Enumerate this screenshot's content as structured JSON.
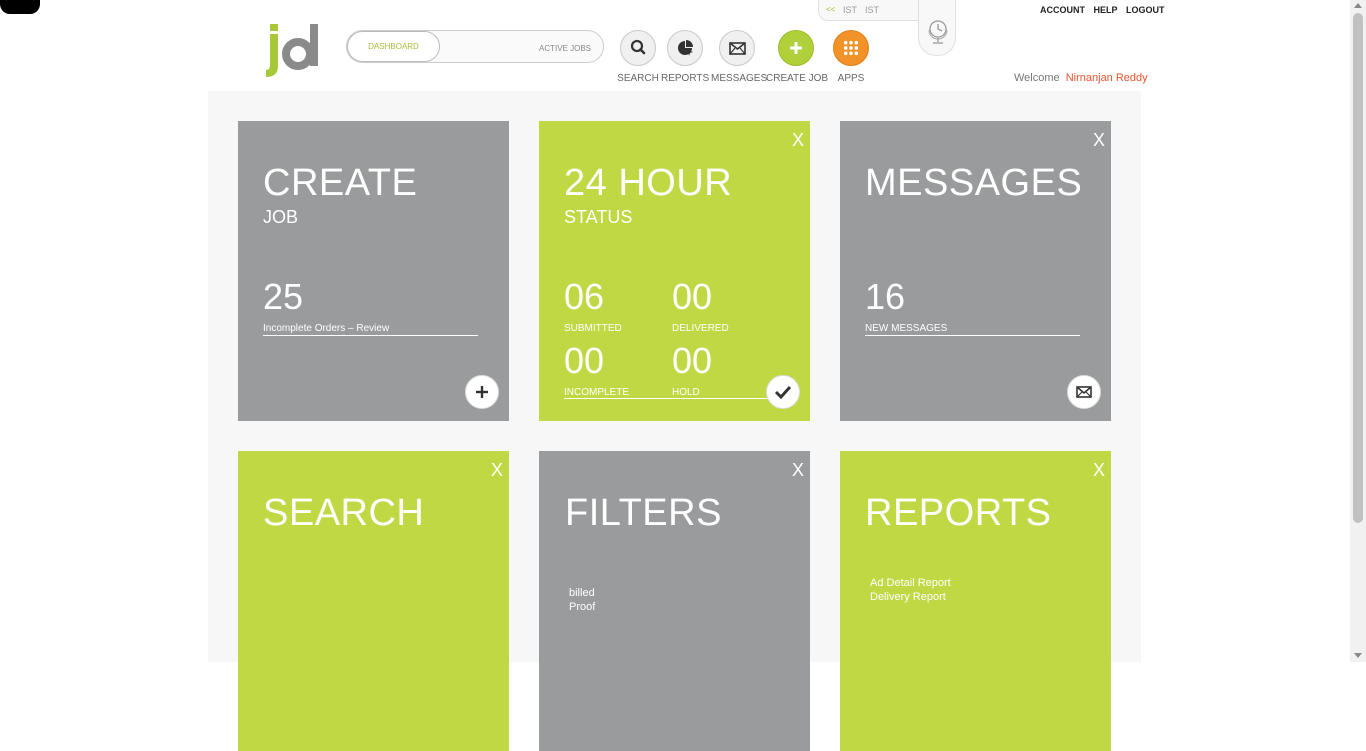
{
  "header": {
    "logo_text": "jd",
    "segment": {
      "active": "DASHBOARD",
      "inactive": "ACTIVE JOBS"
    },
    "nav": [
      {
        "label": "SEARCH",
        "icon": "search-icon"
      },
      {
        "label": "REPORTS",
        "icon": "reports-icon"
      },
      {
        "label": "MESSAGES",
        "icon": "envelope-icon"
      },
      {
        "label": "CREATE JOB",
        "icon": "plus-icon"
      },
      {
        "label": "APPS",
        "icon": "grid-icon"
      }
    ],
    "timezone": {
      "arrow": "<<",
      "tz1": "IST",
      "tz2": "IST"
    },
    "top_links": [
      "ACCOUNT",
      "HELP",
      "LOGOUT"
    ],
    "welcome_label": "Welcome",
    "user_name": "Nirnanjan Reddy"
  },
  "tiles": {
    "create_job": {
      "title": "CREATE",
      "subtitle": "JOB",
      "count": "25",
      "count_label": "Incomplete Orders – Review"
    },
    "status": {
      "title": "24 HOUR",
      "subtitle": "STATUS",
      "close": "X",
      "submitted": {
        "value": "06",
        "label": "SUBMITTED"
      },
      "delivered": {
        "value": "00",
        "label": "DELIVERED"
      },
      "incomplete": {
        "value": "00",
        "label": "INCOMPLETE"
      },
      "hold": {
        "value": "00",
        "label": "HOLD"
      }
    },
    "messages": {
      "title": "MESSAGES",
      "close": "X",
      "count": "16",
      "count_label": "NEW MESSAGES"
    },
    "search": {
      "title": "SEARCH",
      "close": "X"
    },
    "filters": {
      "title": "FILTERS",
      "close": "X",
      "items": [
        "billed",
        "Proof"
      ]
    },
    "reports": {
      "title": "REPORTS",
      "close": "X",
      "items": [
        "Ad Detail Report",
        "Delivery Report"
      ]
    }
  },
  "colors": {
    "green": "#bfd843",
    "grey": "#9a9b9d",
    "orange": "#f2932a",
    "accent_name": "#e8542e"
  }
}
